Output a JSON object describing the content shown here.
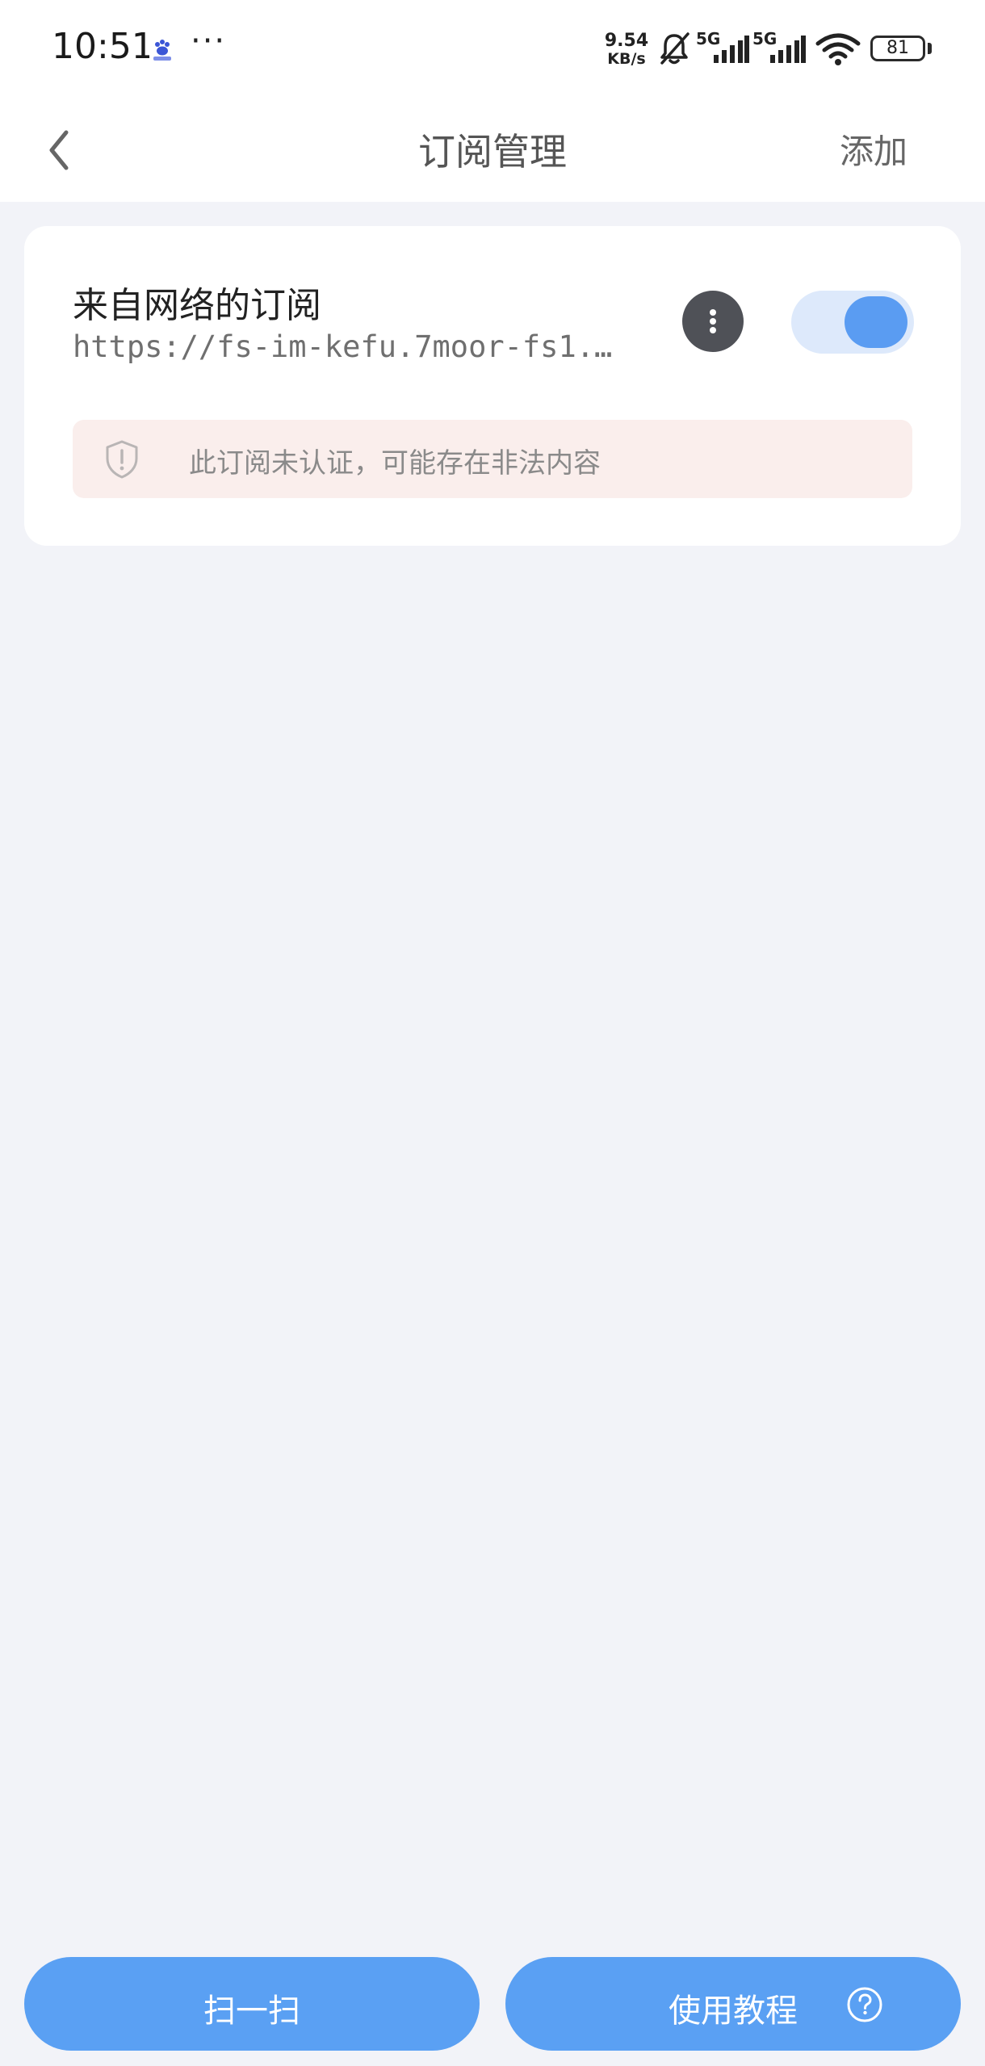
{
  "status_bar": {
    "time": "10:51",
    "more_indicator": "···",
    "net_speed_value": "9.54",
    "net_speed_unit": "KB/s",
    "signal1_label": "5G",
    "signal2_label": "5G",
    "battery_level": "81",
    "icons": [
      "baidu-app-icon",
      "mute-bell-icon",
      "signal-icon",
      "signal-icon",
      "wifi-icon",
      "battery-icon"
    ]
  },
  "nav": {
    "title": "订阅管理",
    "add_label": "添加",
    "back_icon": "chevron-left-icon"
  },
  "subscription": {
    "title": "来自网络的订阅",
    "url": "https://fs-im-kefu.7moor-fs1.…",
    "enabled": true,
    "more_icon": "more-vertical-icon",
    "warning_text": "此订阅未认证，可能存在非法内容",
    "warning_icon": "shield-alert-icon"
  },
  "bottom": {
    "scan_label": "扫一扫",
    "tutorial_label": "使用教程",
    "help_icon": "question-circle-icon"
  },
  "colors": {
    "page_background": "#f2f3f8",
    "accent_blue": "#5aa0f3",
    "toggle_track": "#dde9fb",
    "warning_background": "#faeeec",
    "more_button": "#4f5157"
  }
}
